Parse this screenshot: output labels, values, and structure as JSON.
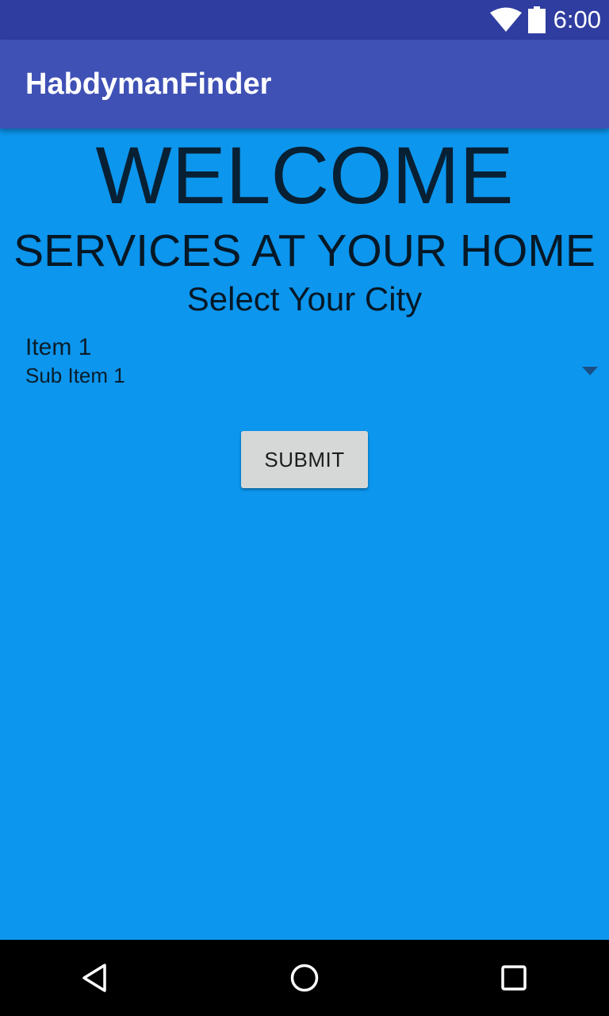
{
  "status_bar": {
    "time": "6:00",
    "icons": [
      "wifi-icon",
      "battery-icon"
    ]
  },
  "app_bar": {
    "title": "HabdymanFinder"
  },
  "main": {
    "welcome": "WELCOME",
    "services": "SERVICES AT YOUR HOME",
    "select_city": "Select Your City",
    "spinner": {
      "item": "Item 1",
      "sub_item": "Sub Item 1"
    },
    "submit_label": "SUBMIT"
  },
  "nav_bar": {
    "icons": [
      "back-icon",
      "home-icon",
      "recents-icon"
    ]
  },
  "colors": {
    "background": "#0c96ee",
    "status_bar": "#2f3da0",
    "app_bar": "#3f51b5",
    "button": "#d6d7d7",
    "nav_bar": "#000000"
  }
}
